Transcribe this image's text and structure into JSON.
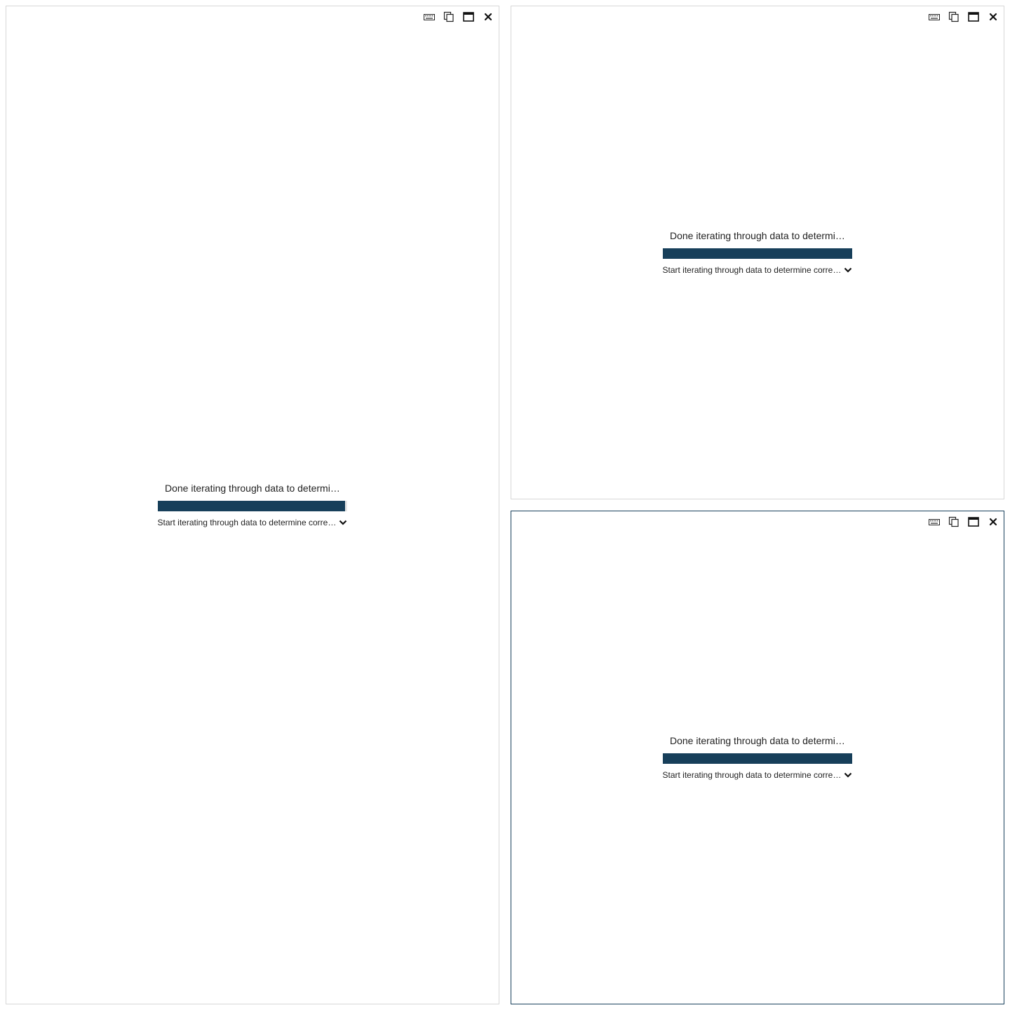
{
  "panels": [
    {
      "status": {
        "title": "Done iterating through data to determine correct data types",
        "progress_percent": 99,
        "detail": "Start iterating through data to determine correct data types"
      }
    },
    {
      "status": {
        "title": "Done iterating through data to determine correct data types",
        "progress_percent": 100,
        "detail": "Start iterating through data to determine correct data types"
      }
    },
    {
      "status": {
        "title": "Done iterating through data to determine correct data types",
        "progress_percent": 100,
        "detail": "Start iterating through data to determine correct data types"
      }
    }
  ],
  "toolbar_icons": [
    "keyboard-icon",
    "copy-icon",
    "maximize-icon",
    "close-icon"
  ],
  "colors": {
    "accent": "#173f5a",
    "panel_border": "#d6d6d6",
    "track": "#e6e6e6"
  }
}
